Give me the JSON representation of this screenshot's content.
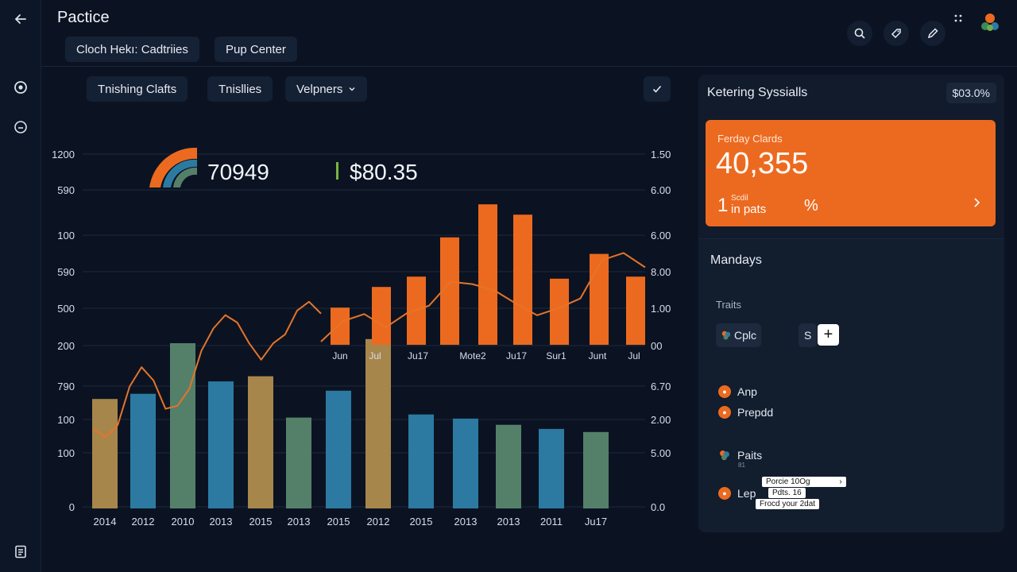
{
  "app": {
    "title": "Pactice"
  },
  "header": {
    "tabs": [
      {
        "label": "Cloch Hekı: Cadtriies"
      },
      {
        "label": "Pup Center"
      }
    ]
  },
  "toolbar": {
    "chips": [
      {
        "label": "Tnishing Clafts"
      },
      {
        "label": "Tnisllies"
      },
      {
        "label": "Velpners"
      }
    ]
  },
  "chart_data": {
    "type": "bar",
    "kpis": [
      {
        "value": "70949"
      },
      {
        "value": "$80.35"
      }
    ],
    "y_left_ticks": [
      "1200",
      "590",
      "100",
      "590",
      "500",
      "200",
      "790",
      "100",
      "100",
      "0"
    ],
    "y_right_ticks": [
      "1.50",
      "6.00",
      "6.00",
      "8.00",
      "1.00",
      "00",
      "6.70",
      "2.00",
      "5.00",
      "0.0"
    ],
    "lower": {
      "categories": [
        "2014",
        "2012",
        "2010",
        "2013",
        "2015",
        "2013",
        "2015",
        "2012",
        "2015",
        "2013",
        "2013",
        "2011",
        "Ju17"
      ],
      "values": [
        530,
        555,
        800,
        615,
        640,
        440,
        570,
        820,
        455,
        435,
        405,
        385,
        370
      ],
      "colors": [
        "#a7864b",
        "#2c7aa2",
        "#54806a",
        "#2c7aa2",
        "#a7864b",
        "#54806a",
        "#2c7aa2",
        "#a7864b",
        "#2c7aa2",
        "#2c7aa2",
        "#54806a",
        "#2c7aa2",
        "#54806a"
      ],
      "line": [
        530,
        480,
        560,
        820,
        950,
        860,
        670,
        690,
        805,
        1060,
        1210,
        1300,
        1250,
        1110,
        1000,
        1110,
        1170,
        1330,
        1390,
        1310
      ]
    },
    "upper": {
      "categories": [
        "Jun",
        "Jul",
        "Ju17",
        "Mote2",
        "Ju17",
        "Sur1",
        "Junt",
        "Jul"
      ],
      "values": [
        90,
        140,
        165,
        260,
        340,
        315,
        160,
        220,
        165
      ],
      "line": [
        0,
        85,
        115,
        60,
        120,
        150,
        250,
        240,
        215,
        160,
        110,
        140,
        180,
        340,
        370,
        310
      ]
    }
  },
  "panel": {
    "title": "Ketering Syssialls",
    "badge": "$03.0%",
    "kpi": {
      "label": "Ferday Clards",
      "value": "40,355",
      "number": "1",
      "sub_top": "Scdil",
      "sub_bottom": "in pats",
      "percent": "%"
    },
    "section": {
      "title": "Mandays",
      "label": "Traits",
      "tag1": "Cplc",
      "tag2": "S",
      "plus": "+",
      "items": [
        {
          "label": "Anp"
        },
        {
          "label": "Prepdd"
        },
        {
          "label": "Paits"
        },
        {
          "label": "Lep"
        }
      ],
      "paits_sub": "81",
      "tooltips": [
        "Porcie 10Og",
        "Pdts. 16",
        "Frocd your 2dat"
      ]
    }
  },
  "colors": {
    "accent": "#ec6a1f",
    "blue": "#2c7aa2",
    "gold": "#a7864b",
    "green": "#54806a"
  }
}
